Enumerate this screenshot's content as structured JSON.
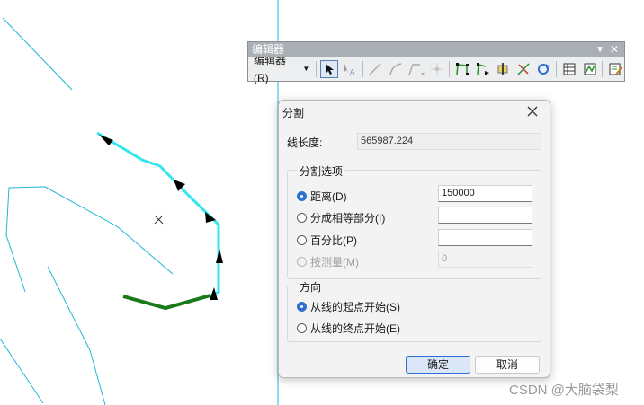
{
  "toolbar": {
    "title": "编辑器",
    "menu_label": "编辑器(R)",
    "colors": {
      "title_bar": "#a9afb5",
      "body": "#eceeef"
    }
  },
  "dialog": {
    "title": "分割",
    "line_length_label": "线长度:",
    "line_length_value": "565987.224",
    "split_options_title": "分割选项",
    "options": [
      {
        "label": "距离(D)",
        "value": "150000",
        "checked": true,
        "enabled": true
      },
      {
        "label": "分成相等部分(I)",
        "value": "",
        "checked": false,
        "enabled": true
      },
      {
        "label": "百分比(P)",
        "value": "",
        "checked": false,
        "enabled": true
      },
      {
        "label": "按测量(M)",
        "value": "0",
        "checked": false,
        "enabled": false
      }
    ],
    "direction_title": "方向",
    "directions": [
      {
        "label": "从线的起点开始(S)",
        "checked": true
      },
      {
        "label": "从线的终点开始(E)",
        "checked": false
      }
    ],
    "ok_label": "确定",
    "cancel_label": "取消"
  },
  "watermark": "CSDN @大脑袋梨",
  "colors": {
    "map_lines": "#1fb8d8",
    "selected_line": "#33e6ee",
    "green_line": "#1a7a1a",
    "accent": "#2f6fd1"
  }
}
